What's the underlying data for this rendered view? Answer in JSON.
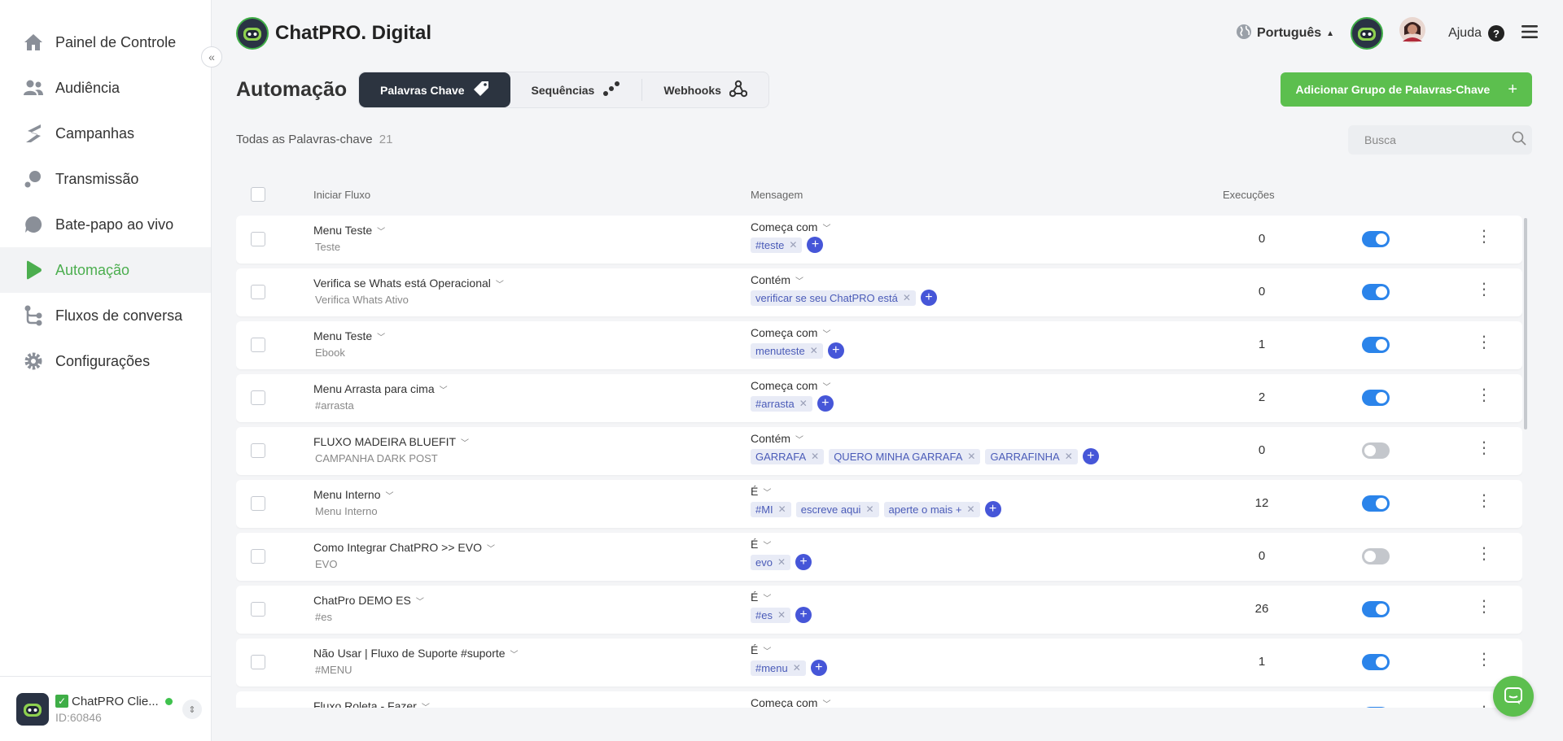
{
  "sidebar": {
    "items": [
      {
        "label": "Painel de Controle",
        "icon": "home-icon"
      },
      {
        "label": "Audiência",
        "icon": "users-icon"
      },
      {
        "label": "Campanhas",
        "icon": "campaigns-icon"
      },
      {
        "label": "Transmissão",
        "icon": "broadcast-icon"
      },
      {
        "label": "Bate-papo ao vivo",
        "icon": "chat-icon"
      },
      {
        "label": "Automação",
        "icon": "play-icon",
        "active": true
      },
      {
        "label": "Fluxos de conversa",
        "icon": "flow-icon"
      },
      {
        "label": "Configurações",
        "icon": "gear-icon"
      }
    ],
    "account": {
      "name": "ChatPRO Clie...",
      "id": "ID:60846"
    }
  },
  "header": {
    "brand": "ChatPRO. Digital",
    "language": "Português",
    "help": "Ajuda"
  },
  "page": {
    "title": "Automação",
    "tabs": [
      {
        "label": "Palavras Chave",
        "active": true
      },
      {
        "label": "Sequências"
      },
      {
        "label": "Webhooks"
      }
    ],
    "add_button": "Adicionar Grupo de Palavras-Chave",
    "count_label": "Todas as Palavras-chave",
    "count": "21",
    "search_placeholder": "Busca"
  },
  "table": {
    "headers": {
      "flow": "Iniciar Fluxo",
      "message": "Mensagem",
      "executions": "Execuções"
    },
    "rows": [
      {
        "name": "Menu Teste",
        "sub": "Teste",
        "type": "Começa com",
        "tags": [
          "#teste"
        ],
        "executions": "0",
        "enabled": true
      },
      {
        "name": "Verifica se Whats está Operacional",
        "sub": "Verifica Whats Ativo",
        "type": "Contém",
        "tags": [
          "verificar se seu ChatPRO está"
        ],
        "executions": "0",
        "enabled": true
      },
      {
        "name": "Menu Teste",
        "sub": "Ebook",
        "type": "Começa com",
        "tags": [
          "menuteste"
        ],
        "executions": "1",
        "enabled": true
      },
      {
        "name": "Menu Arrasta para cima",
        "sub": "#arrasta",
        "type": "Começa com",
        "tags": [
          "#arrasta"
        ],
        "executions": "2",
        "enabled": true
      },
      {
        "name": "FLUXO MADEIRA BLUEFIT",
        "sub": "CAMPANHA DARK POST",
        "type": "Contém",
        "tags": [
          "GARRAFA",
          "QUERO MINHA GARRAFA",
          "GARRAFINHA"
        ],
        "executions": "0",
        "enabled": false
      },
      {
        "name": "Menu Interno",
        "sub": "Menu Interno",
        "type": "É",
        "tags": [
          "#MI",
          "escreve aqui",
          "aperte o mais +"
        ],
        "executions": "12",
        "enabled": true
      },
      {
        "name": "Como Integrar ChatPRO >> EVO",
        "sub": "EVO",
        "type": "É",
        "tags": [
          "evo"
        ],
        "executions": "0",
        "enabled": false
      },
      {
        "name": "ChatPro DEMO ES",
        "sub": "#es",
        "type": "É",
        "tags": [
          "#es"
        ],
        "executions": "26",
        "enabled": true
      },
      {
        "name": "Não Usar | Fluxo de Suporte #suporte",
        "sub": "#MENU",
        "type": "É",
        "tags": [
          "#menu"
        ],
        "executions": "1",
        "enabled": true
      },
      {
        "name": "Fluxo Roleta - Fazer",
        "sub": "",
        "type": "Começa com",
        "tags": [],
        "executions": "",
        "enabled": true
      }
    ]
  },
  "colors": {
    "accent": "#5cbf4e",
    "toggle_on": "#2b84ea",
    "tag_bg": "#e8ebf6",
    "tag_text": "#4a5bb8",
    "tab_active": "#2c3440"
  }
}
